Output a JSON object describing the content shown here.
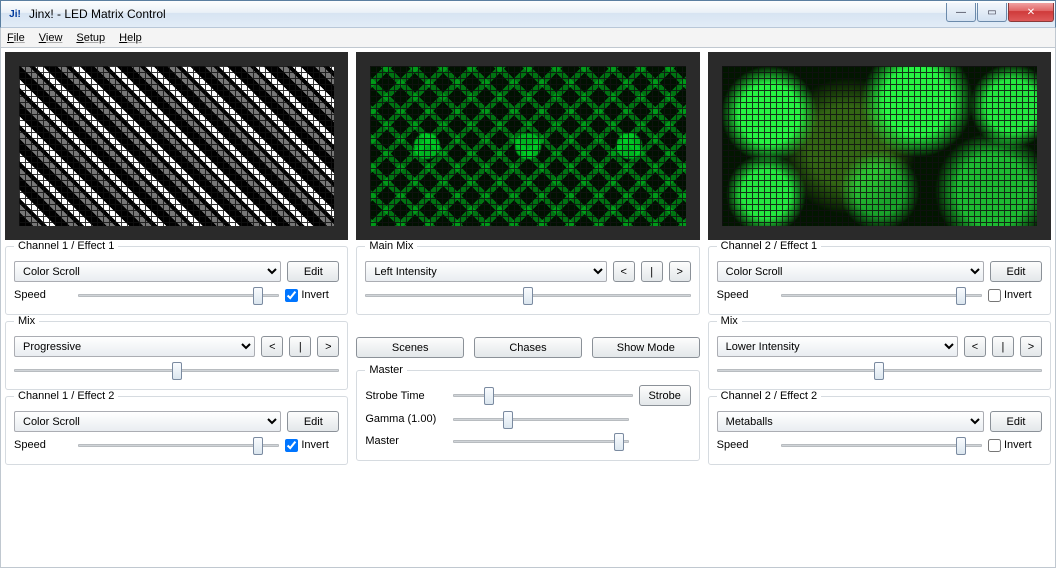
{
  "window": {
    "title": "Jinx! - LED Matrix Control",
    "app_icon_text": "Ji!",
    "minimize": "—",
    "maximize": "▭",
    "close": "✕"
  },
  "menu": {
    "file": "File",
    "view": "View",
    "setup": "Setup",
    "help": "Help"
  },
  "left": {
    "effect1": {
      "label": "Channel 1 / Effect 1",
      "combo": "Color Scroll",
      "edit": "Edit",
      "speed_label": "Speed",
      "speed_value": 92,
      "invert_label": "Invert",
      "invert_checked": true
    },
    "mix": {
      "label": "Mix",
      "combo": "Progressive",
      "btn_prev": "<",
      "btn_pause": "|",
      "btn_next": ">",
      "mix_value": 50
    },
    "effect2": {
      "label": "Channel 1 / Effect 2",
      "combo": "Color Scroll",
      "edit": "Edit",
      "speed_label": "Speed",
      "speed_value": 92,
      "invert_label": "Invert",
      "invert_checked": true
    }
  },
  "center": {
    "mainmix": {
      "label": "Main Mix",
      "combo": "Left Intensity",
      "btn_prev": "<",
      "btn_pause": "|",
      "btn_next": ">",
      "mix_value": 50
    },
    "buttons": {
      "scenes": "Scenes",
      "chases": "Chases",
      "showmode": "Show Mode"
    },
    "master": {
      "label": "Master",
      "strobe_time_label": "Strobe Time",
      "strobe_time_value": 18,
      "strobe_btn": "Strobe",
      "gamma_label": "Gamma (1.00)",
      "gamma_value": 30,
      "master_label": "Master",
      "master_value": 98
    }
  },
  "right": {
    "effect1": {
      "label": "Channel 2 / Effect 1",
      "combo": "Color Scroll",
      "edit": "Edit",
      "speed_label": "Speed",
      "speed_value": 92,
      "invert_label": "Invert",
      "invert_checked": false
    },
    "mix": {
      "label": "Mix",
      "combo": "Lower Intensity",
      "btn_prev": "<",
      "btn_pause": "|",
      "btn_next": ">",
      "mix_value": 50
    },
    "effect2": {
      "label": "Channel 2 / Effect 2",
      "combo": "Metaballs",
      "edit": "Edit",
      "speed_label": "Speed",
      "speed_value": 92,
      "invert_label": "Invert",
      "invert_checked": false
    }
  }
}
